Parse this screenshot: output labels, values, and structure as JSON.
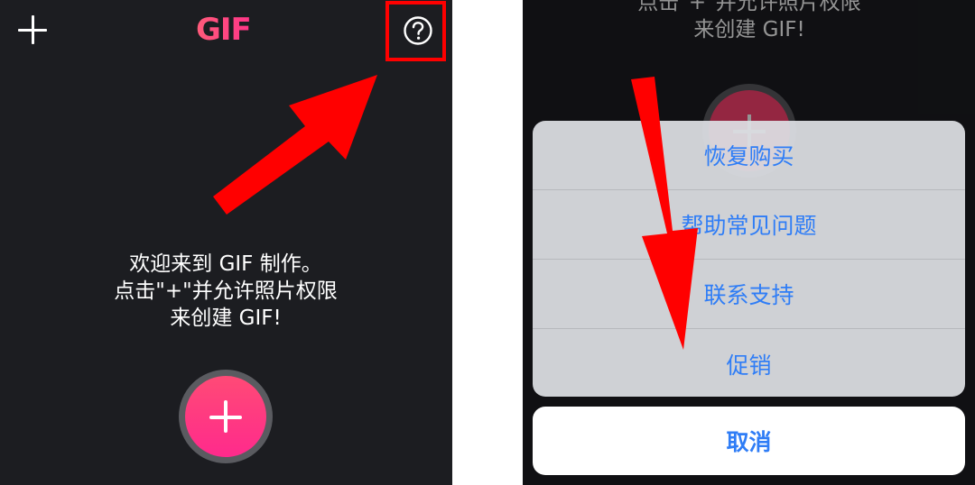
{
  "left_screen": {
    "app_title": "GIF",
    "welcome_lines": [
      "欢迎来到 GIF 制作。",
      "点击\"+\"并允许照片权限",
      "来创建 GIF!"
    ],
    "icons": {
      "add": "plus-icon",
      "help": "question-circle-icon",
      "create": "plus-icon"
    }
  },
  "right_screen": {
    "background_lines": [
      "点击\"+\"并允许照片权限",
      "来创建 GIF!"
    ],
    "action_sheet": {
      "items": [
        {
          "label": "恢复购买"
        },
        {
          "label": "帮助常见问题"
        },
        {
          "label": "联系支持"
        },
        {
          "label": "促销"
        }
      ],
      "cancel_label": "取消"
    }
  },
  "colors": {
    "background": "#1c1d21",
    "accent": "#ff3d7f",
    "link_blue": "#2f7df6",
    "annotation_red": "#ff0000"
  }
}
